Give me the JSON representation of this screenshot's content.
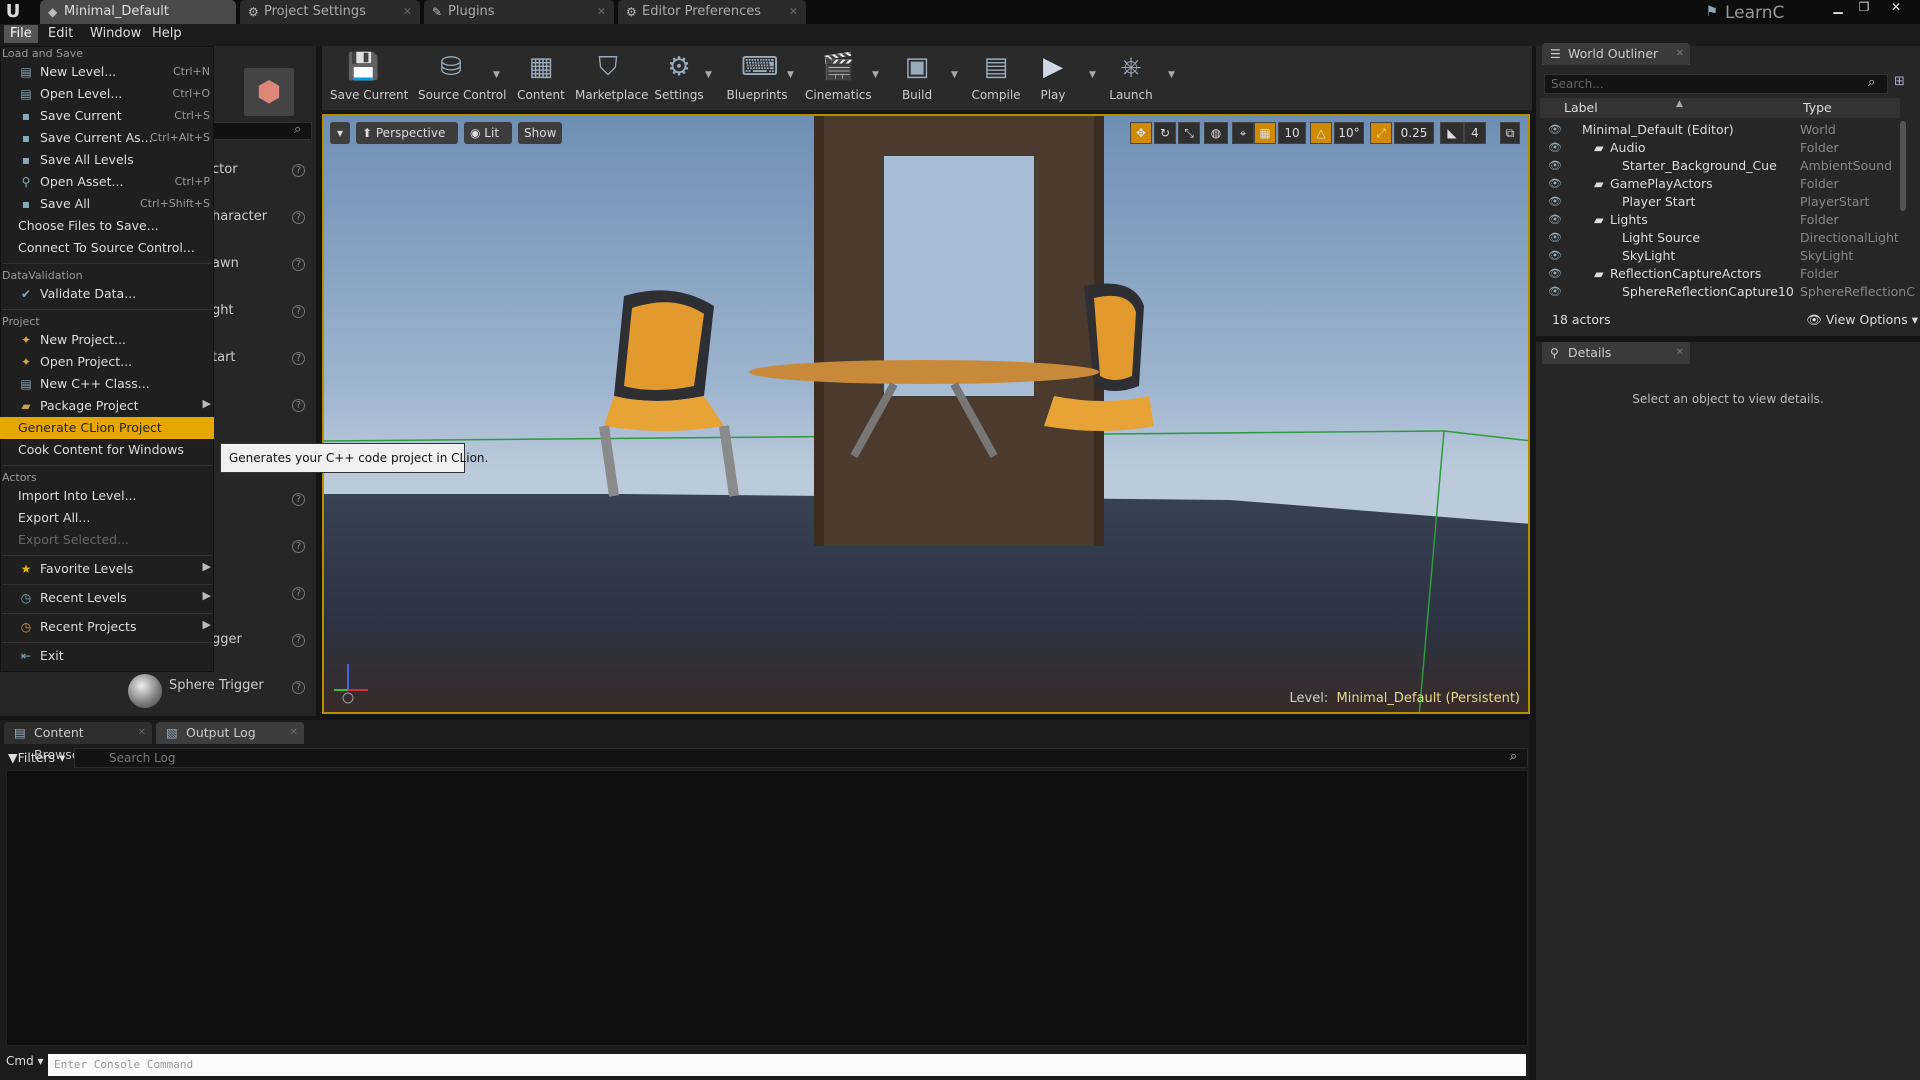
{
  "titlebar": {
    "tabs": [
      {
        "label": "Minimal_Default",
        "icon": "unreal-level-icon"
      },
      {
        "label": "Project Settings",
        "icon": "gear-icon"
      },
      {
        "label": "Plugins",
        "icon": "plug-icon"
      },
      {
        "label": "Editor Preferences",
        "icon": "gear-icon"
      }
    ],
    "learn_label": "LearnC"
  },
  "menubar": [
    "File",
    "Edit",
    "Window",
    "Help"
  ],
  "file_menu": {
    "sections": {
      "load_save": "Load and Save",
      "data_validation": "DataValidation",
      "project": "Project",
      "actors": "Actors"
    },
    "items": {
      "new_level": {
        "label": "New Level...",
        "shortcut": "Ctrl+N"
      },
      "open_level": {
        "label": "Open Level...",
        "shortcut": "Ctrl+O"
      },
      "save_current": {
        "label": "Save Current",
        "shortcut": "Ctrl+S"
      },
      "save_current_as": {
        "label": "Save Current As...",
        "shortcut": "Ctrl+Alt+S"
      },
      "save_all_levels": {
        "label": "Save All Levels"
      },
      "open_asset": {
        "label": "Open Asset...",
        "shortcut": "Ctrl+P"
      },
      "save_all": {
        "label": "Save All",
        "shortcut": "Ctrl+Shift+S"
      },
      "choose_files": {
        "label": "Choose Files to Save..."
      },
      "connect_source": {
        "label": "Connect To Source Control..."
      },
      "validate_data": {
        "label": "Validate Data..."
      },
      "new_project": {
        "label": "New Project..."
      },
      "open_project": {
        "label": "Open Project..."
      },
      "new_cpp_class": {
        "label": "New C++ Class..."
      },
      "package_project": {
        "label": "Package Project"
      },
      "generate_clion": {
        "label": "Generate CLion Project"
      },
      "cook_content": {
        "label": "Cook Content for Windows"
      },
      "import_into_level": {
        "label": "Import Into Level..."
      },
      "export_all": {
        "label": "Export All..."
      },
      "export_selected": {
        "label": "Export Selected..."
      },
      "favorite_levels": {
        "label": "Favorite Levels"
      },
      "recent_levels": {
        "label": "Recent Levels"
      },
      "recent_projects": {
        "label": "Recent Projects"
      },
      "exit": {
        "label": "Exit"
      }
    },
    "tooltip": "Generates your C++ code project in CLion."
  },
  "place_panel": {
    "items": [
      "ctor",
      "haracter",
      "awn",
      "ght",
      "tart",
      "gger",
      "Sphere Trigger"
    ]
  },
  "toolbar": {
    "buttons": [
      {
        "label": "Save Current"
      },
      {
        "label": "Source Control"
      },
      {
        "label": "Content"
      },
      {
        "label": "Marketplace"
      },
      {
        "label": "Settings"
      },
      {
        "label": "Blueprints"
      },
      {
        "label": "Cinematics"
      },
      {
        "label": "Build"
      },
      {
        "label": "Compile"
      },
      {
        "label": "Play"
      },
      {
        "label": "Launch"
      }
    ]
  },
  "viewport": {
    "perspective": "Perspective",
    "lit": "Lit",
    "show": "Show",
    "grid_snap": "10",
    "rot_snap": "10°",
    "scale_snap": "0.25",
    "camera_speed": "4",
    "level_prefix": "Level:",
    "level_name": "Minimal_Default (Persistent)"
  },
  "world_outliner": {
    "tab": "World Outliner",
    "search_placeholder": "Search...",
    "col_label": "Label",
    "col_type": "Type",
    "rows": [
      {
        "label": "Minimal_Default (Editor)",
        "type": "World"
      },
      {
        "label": "Audio",
        "type": "Folder"
      },
      {
        "label": "Starter_Background_Cue",
        "type": "AmbientSound"
      },
      {
        "label": "GamePlayActors",
        "type": "Folder"
      },
      {
        "label": "Player Start",
        "type": "PlayerStart"
      },
      {
        "label": "Lights",
        "type": "Folder"
      },
      {
        "label": "Light Source",
        "type": "DirectionalLight"
      },
      {
        "label": "SkyLight",
        "type": "SkyLight"
      },
      {
        "label": "ReflectionCaptureActors",
        "type": "Folder"
      },
      {
        "label": "SphereReflectionCapture10",
        "type": "SphereReflectionC"
      }
    ],
    "actor_count": "18 actors",
    "view_options": "View Options"
  },
  "details": {
    "tab": "Details",
    "empty_text": "Select an object to view details."
  },
  "bottom": {
    "tabs": [
      "Content Browser",
      "Output Log"
    ],
    "filters": "Filters",
    "search_placeholder": "Search Log",
    "cmd_label": "Cmd",
    "cmd_placeholder": "Enter Console Command"
  },
  "colors": {
    "accent": "#e6a700",
    "viewport_border": "#b58e00"
  }
}
